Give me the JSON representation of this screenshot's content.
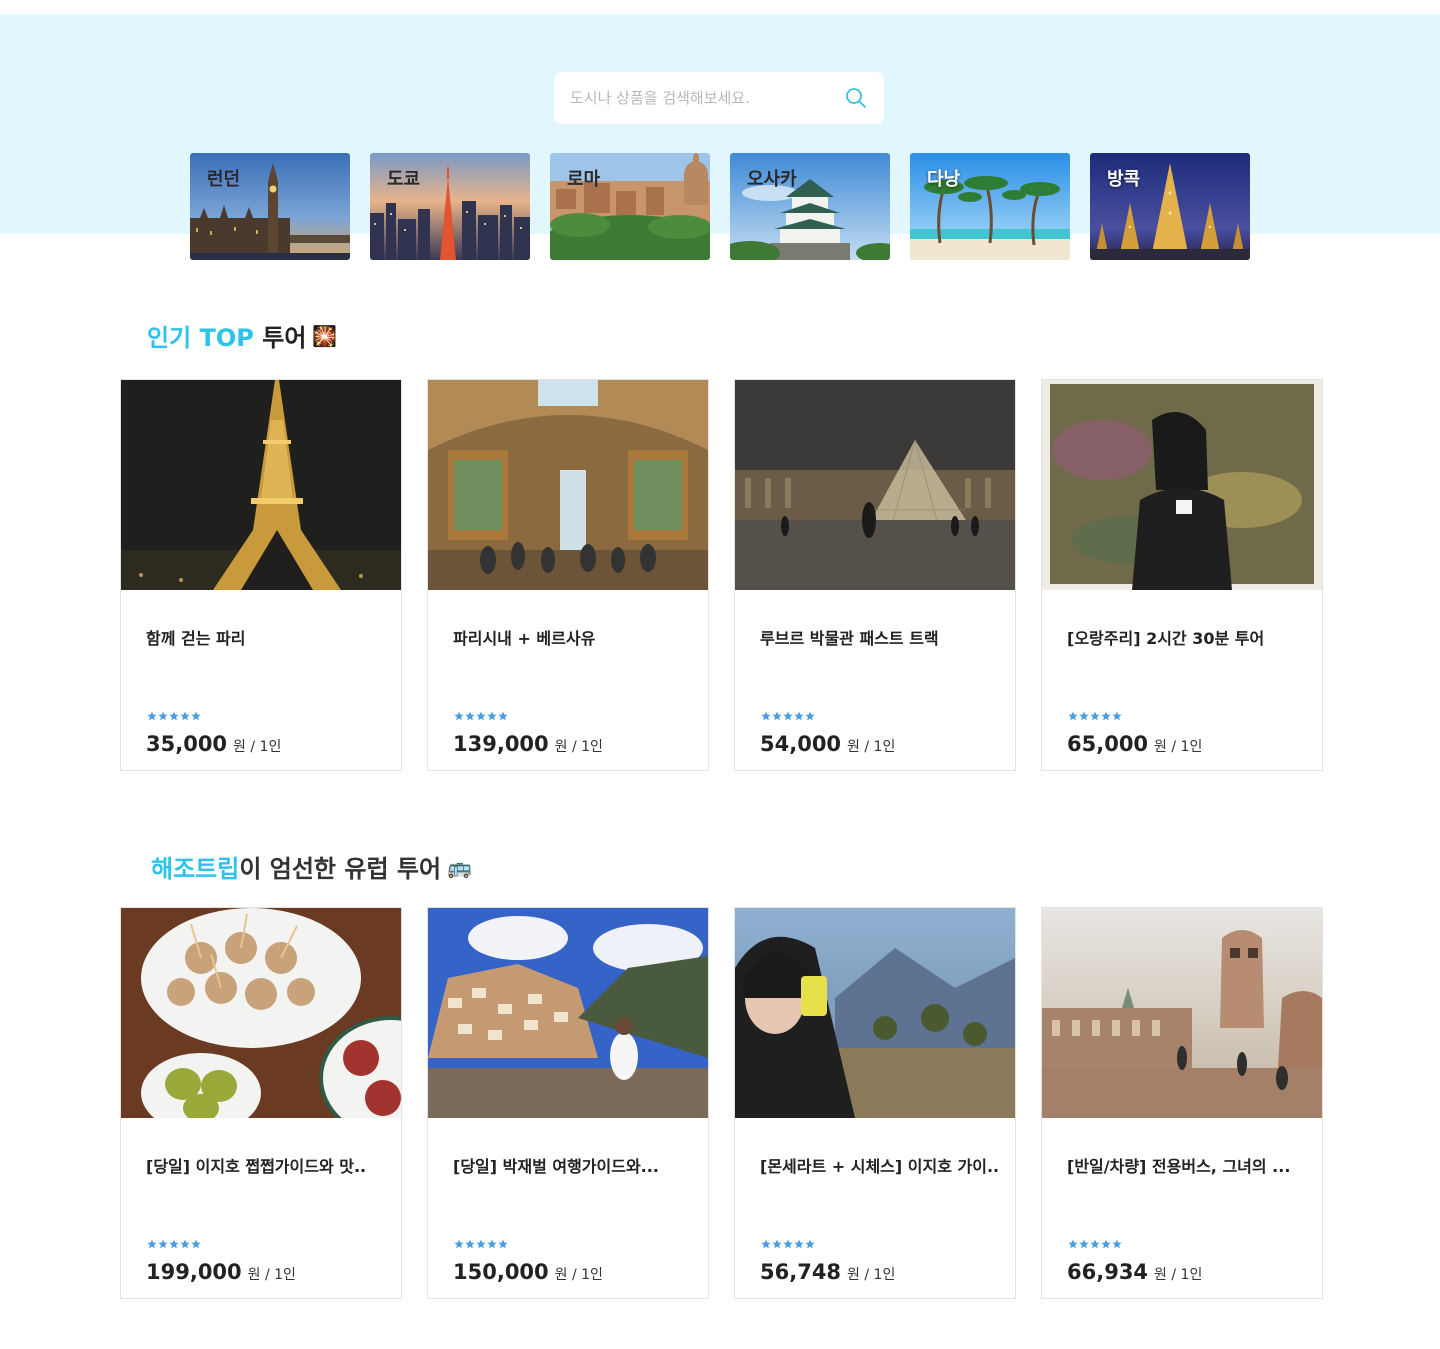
{
  "search": {
    "placeholder": "도시나 상품을 검색해보세요."
  },
  "cities": [
    {
      "label": "런던"
    },
    {
      "label": "도쿄"
    },
    {
      "label": "로마"
    },
    {
      "label": "오사카"
    },
    {
      "label": "다낭"
    },
    {
      "label": "방콕"
    }
  ],
  "section1": {
    "highlight": "인기 TOP",
    "rest": " 투어",
    "emoji": "🎇"
  },
  "section2": {
    "highlight": "해조트립",
    "rest": "이 엄선한 유럽 투어",
    "emoji": "🚌"
  },
  "top_tours": [
    {
      "title": "함께 걷는 파리",
      "price": "35,000",
      "unit": "원 / 1인",
      "rating": 5
    },
    {
      "title": "파리시내 + 베르사유",
      "price": "139,000",
      "unit": "원 / 1인",
      "rating": 5
    },
    {
      "title": "루브르 박물관 패스트 트랙",
      "price": "54,000",
      "unit": "원 / 1인",
      "rating": 5
    },
    {
      "title": "[오랑주리] 2시간 30분 투어",
      "price": "65,000",
      "unit": "원 / 1인",
      "rating": 5
    }
  ],
  "picked_tours": [
    {
      "title": "[당일] 이지호 쩝쩝가이드와 맛..",
      "price": "199,000",
      "unit": "원 / 1인",
      "rating": 5
    },
    {
      "title": "[당일] 박재벌 여행가이드와...",
      "price": "150,000",
      "unit": "원 / 1인",
      "rating": 5
    },
    {
      "title": "[몬세라트 + 시체스] 이지호 가이..",
      "price": "56,748",
      "unit": "원 / 1인",
      "rating": 5
    },
    {
      "title": "[반일/차량] 전용버스, 그녀의 ...",
      "price": "66,934",
      "unit": "원 / 1인",
      "rating": 5
    }
  ],
  "colors": {
    "hero_bg": "#e2f7fd",
    "accent": "#2cc3ec",
    "star": "#4a9de0"
  }
}
